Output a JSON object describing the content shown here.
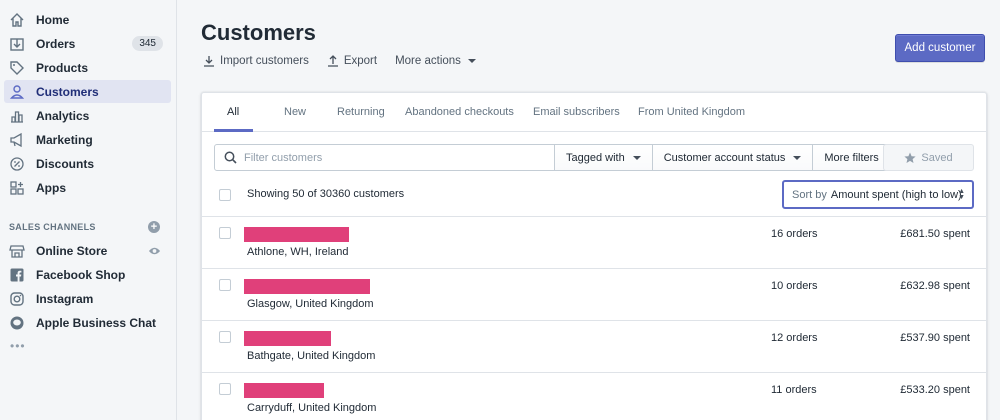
{
  "sidebar": {
    "items": [
      {
        "label": "Home",
        "icon": "home-icon"
      },
      {
        "label": "Orders",
        "icon": "orders-icon",
        "badge": "345"
      },
      {
        "label": "Products",
        "icon": "tag-icon"
      },
      {
        "label": "Customers",
        "icon": "person-icon",
        "active": true
      },
      {
        "label": "Analytics",
        "icon": "bar-chart-icon"
      },
      {
        "label": "Marketing",
        "icon": "megaphone-icon"
      },
      {
        "label": "Discounts",
        "icon": "discount-icon"
      },
      {
        "label": "Apps",
        "icon": "apps-icon"
      }
    ],
    "section_label": "SALES CHANNELS",
    "channels": [
      {
        "label": "Online Store",
        "icon": "store-icon"
      },
      {
        "label": "Facebook Shop",
        "icon": "facebook-icon"
      },
      {
        "label": "Instagram",
        "icon": "instagram-icon"
      },
      {
        "label": "Apple Business Chat",
        "icon": "chat-icon"
      }
    ],
    "more": "•••"
  },
  "page": {
    "title": "Customers",
    "actions": {
      "import": "Import customers",
      "export": "Export",
      "more": "More actions"
    },
    "add_button": "Add customer"
  },
  "tabs": [
    "All",
    "New",
    "Returning",
    "Abandoned checkouts",
    "Email subscribers",
    "From United Kingdom"
  ],
  "filters": {
    "search_placeholder": "Filter customers",
    "tagged_with": "Tagged with",
    "account_status": "Customer account status",
    "more_filters": "More filters",
    "saved": "Saved"
  },
  "list": {
    "showing": "Showing 50 of 30360 customers",
    "sort_label": "Sort by",
    "sort_value": "Amount spent (high to low)",
    "rows": [
      {
        "location": "Athlone, WH, Ireland",
        "orders": "16 orders",
        "spent": "£681.50 spent"
      },
      {
        "location": "Glasgow, United Kingdom",
        "orders": "10 orders",
        "spent": "£632.98 spent"
      },
      {
        "location": "Bathgate, United Kingdom",
        "orders": "12 orders",
        "spent": "£537.90 spent"
      },
      {
        "location": "Carryduff, United Kingdom",
        "orders": "11 orders",
        "spent": "£533.20 spent"
      }
    ]
  },
  "colors": {
    "accent": "#5c6ac4",
    "redaction": "#e0407a",
    "active_nav_bg": "#e1e4f2"
  }
}
